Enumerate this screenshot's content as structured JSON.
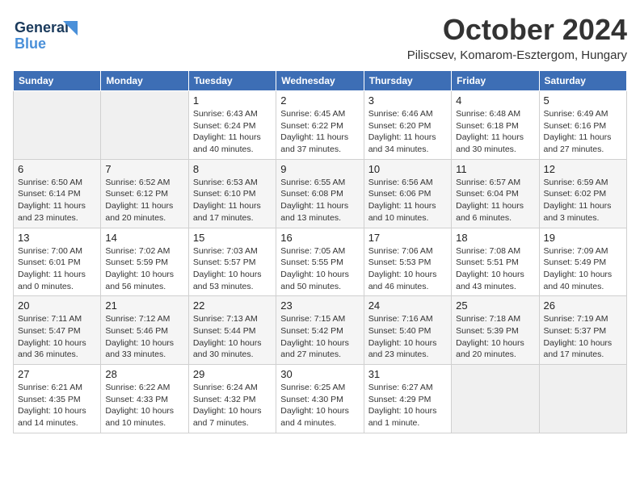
{
  "header": {
    "logo_general": "General",
    "logo_blue": "Blue",
    "month_title": "October 2024",
    "location": "Piliscsev, Komarom-Esztergom, Hungary"
  },
  "weekdays": [
    "Sunday",
    "Monday",
    "Tuesday",
    "Wednesday",
    "Thursday",
    "Friday",
    "Saturday"
  ],
  "weeks": [
    [
      {
        "day": "",
        "empty": true
      },
      {
        "day": "",
        "empty": true
      },
      {
        "day": "1",
        "sunrise": "Sunrise: 6:43 AM",
        "sunset": "Sunset: 6:24 PM",
        "daylight": "Daylight: 11 hours and 40 minutes."
      },
      {
        "day": "2",
        "sunrise": "Sunrise: 6:45 AM",
        "sunset": "Sunset: 6:22 PM",
        "daylight": "Daylight: 11 hours and 37 minutes."
      },
      {
        "day": "3",
        "sunrise": "Sunrise: 6:46 AM",
        "sunset": "Sunset: 6:20 PM",
        "daylight": "Daylight: 11 hours and 34 minutes."
      },
      {
        "day": "4",
        "sunrise": "Sunrise: 6:48 AM",
        "sunset": "Sunset: 6:18 PM",
        "daylight": "Daylight: 11 hours and 30 minutes."
      },
      {
        "day": "5",
        "sunrise": "Sunrise: 6:49 AM",
        "sunset": "Sunset: 6:16 PM",
        "daylight": "Daylight: 11 hours and 27 minutes."
      }
    ],
    [
      {
        "day": "6",
        "sunrise": "Sunrise: 6:50 AM",
        "sunset": "Sunset: 6:14 PM",
        "daylight": "Daylight: 11 hours and 23 minutes."
      },
      {
        "day": "7",
        "sunrise": "Sunrise: 6:52 AM",
        "sunset": "Sunset: 6:12 PM",
        "daylight": "Daylight: 11 hours and 20 minutes."
      },
      {
        "day": "8",
        "sunrise": "Sunrise: 6:53 AM",
        "sunset": "Sunset: 6:10 PM",
        "daylight": "Daylight: 11 hours and 17 minutes."
      },
      {
        "day": "9",
        "sunrise": "Sunrise: 6:55 AM",
        "sunset": "Sunset: 6:08 PM",
        "daylight": "Daylight: 11 hours and 13 minutes."
      },
      {
        "day": "10",
        "sunrise": "Sunrise: 6:56 AM",
        "sunset": "Sunset: 6:06 PM",
        "daylight": "Daylight: 11 hours and 10 minutes."
      },
      {
        "day": "11",
        "sunrise": "Sunrise: 6:57 AM",
        "sunset": "Sunset: 6:04 PM",
        "daylight": "Daylight: 11 hours and 6 minutes."
      },
      {
        "day": "12",
        "sunrise": "Sunrise: 6:59 AM",
        "sunset": "Sunset: 6:02 PM",
        "daylight": "Daylight: 11 hours and 3 minutes."
      }
    ],
    [
      {
        "day": "13",
        "sunrise": "Sunrise: 7:00 AM",
        "sunset": "Sunset: 6:01 PM",
        "daylight": "Daylight: 11 hours and 0 minutes."
      },
      {
        "day": "14",
        "sunrise": "Sunrise: 7:02 AM",
        "sunset": "Sunset: 5:59 PM",
        "daylight": "Daylight: 10 hours and 56 minutes."
      },
      {
        "day": "15",
        "sunrise": "Sunrise: 7:03 AM",
        "sunset": "Sunset: 5:57 PM",
        "daylight": "Daylight: 10 hours and 53 minutes."
      },
      {
        "day": "16",
        "sunrise": "Sunrise: 7:05 AM",
        "sunset": "Sunset: 5:55 PM",
        "daylight": "Daylight: 10 hours and 50 minutes."
      },
      {
        "day": "17",
        "sunrise": "Sunrise: 7:06 AM",
        "sunset": "Sunset: 5:53 PM",
        "daylight": "Daylight: 10 hours and 46 minutes."
      },
      {
        "day": "18",
        "sunrise": "Sunrise: 7:08 AM",
        "sunset": "Sunset: 5:51 PM",
        "daylight": "Daylight: 10 hours and 43 minutes."
      },
      {
        "day": "19",
        "sunrise": "Sunrise: 7:09 AM",
        "sunset": "Sunset: 5:49 PM",
        "daylight": "Daylight: 10 hours and 40 minutes."
      }
    ],
    [
      {
        "day": "20",
        "sunrise": "Sunrise: 7:11 AM",
        "sunset": "Sunset: 5:47 PM",
        "daylight": "Daylight: 10 hours and 36 minutes."
      },
      {
        "day": "21",
        "sunrise": "Sunrise: 7:12 AM",
        "sunset": "Sunset: 5:46 PM",
        "daylight": "Daylight: 10 hours and 33 minutes."
      },
      {
        "day": "22",
        "sunrise": "Sunrise: 7:13 AM",
        "sunset": "Sunset: 5:44 PM",
        "daylight": "Daylight: 10 hours and 30 minutes."
      },
      {
        "day": "23",
        "sunrise": "Sunrise: 7:15 AM",
        "sunset": "Sunset: 5:42 PM",
        "daylight": "Daylight: 10 hours and 27 minutes."
      },
      {
        "day": "24",
        "sunrise": "Sunrise: 7:16 AM",
        "sunset": "Sunset: 5:40 PM",
        "daylight": "Daylight: 10 hours and 23 minutes."
      },
      {
        "day": "25",
        "sunrise": "Sunrise: 7:18 AM",
        "sunset": "Sunset: 5:39 PM",
        "daylight": "Daylight: 10 hours and 20 minutes."
      },
      {
        "day": "26",
        "sunrise": "Sunrise: 7:19 AM",
        "sunset": "Sunset: 5:37 PM",
        "daylight": "Daylight: 10 hours and 17 minutes."
      }
    ],
    [
      {
        "day": "27",
        "sunrise": "Sunrise: 6:21 AM",
        "sunset": "Sunset: 4:35 PM",
        "daylight": "Daylight: 10 hours and 14 minutes."
      },
      {
        "day": "28",
        "sunrise": "Sunrise: 6:22 AM",
        "sunset": "Sunset: 4:33 PM",
        "daylight": "Daylight: 10 hours and 10 minutes."
      },
      {
        "day": "29",
        "sunrise": "Sunrise: 6:24 AM",
        "sunset": "Sunset: 4:32 PM",
        "daylight": "Daylight: 10 hours and 7 minutes."
      },
      {
        "day": "30",
        "sunrise": "Sunrise: 6:25 AM",
        "sunset": "Sunset: 4:30 PM",
        "daylight": "Daylight: 10 hours and 4 minutes."
      },
      {
        "day": "31",
        "sunrise": "Sunrise: 6:27 AM",
        "sunset": "Sunset: 4:29 PM",
        "daylight": "Daylight: 10 hours and 1 minute."
      },
      {
        "day": "",
        "empty": true
      },
      {
        "day": "",
        "empty": true
      }
    ]
  ]
}
